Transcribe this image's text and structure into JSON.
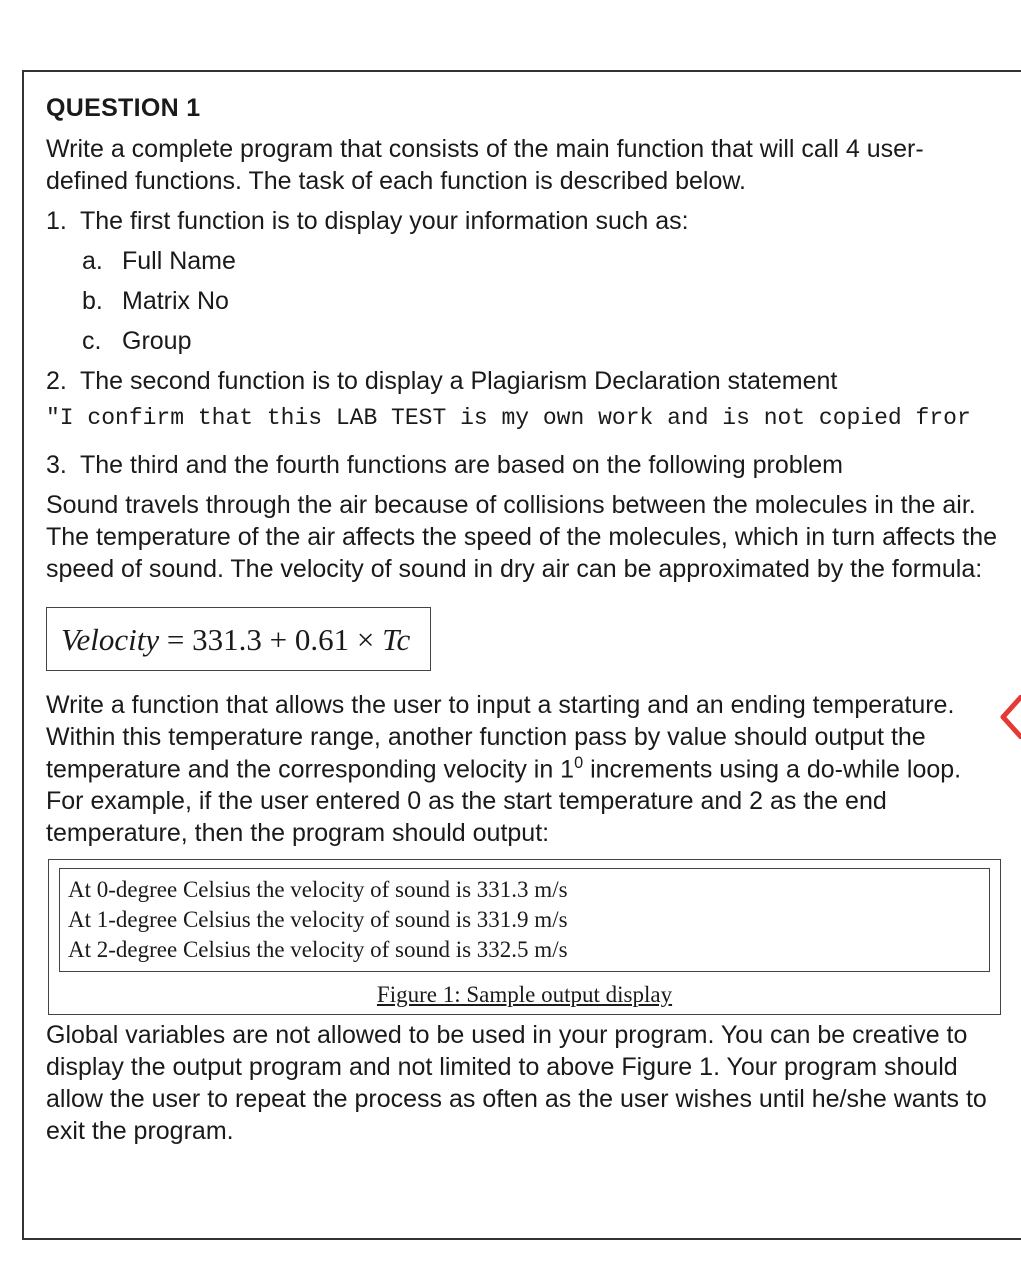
{
  "question": {
    "title": "QUESTION 1",
    "intro": "Write a complete program that consists of the main function that will call 4 user-defined functions. The task of each function is described below.",
    "items": [
      {
        "num": "1.",
        "text": "The first function is to display your information such as:"
      },
      {
        "num": "2.",
        "text": "The second function is to display a Plagiarism Declaration statement"
      },
      {
        "num": "3.",
        "text": "The third and the fourth functions are based on the following problem"
      }
    ],
    "subitems": [
      {
        "num": "a.",
        "text": "Full Name"
      },
      {
        "num": "b.",
        "text": "Matrix No"
      },
      {
        "num": "c.",
        "text": "Group"
      }
    ],
    "plagiarism_code": "\"I confirm that this LAB TEST is my own work and is not copied fror",
    "problem_paragraph": "Sound travels through the air because of collisions between the molecules in the air. The temperature of the air affects the speed of the molecules, which in turn affects the speed of sound. The velocity of sound in dry air can be approximated by the formula:",
    "formula": {
      "lhs": "Velocity",
      "eq": " = ",
      "rhs_a": "331.3 + 0.61 × ",
      "rhs_var": "Tc"
    },
    "task_paragraph_a": "Write a function that allows the user to input a starting and an ending temperature. Within this temperature range, another function pass by value should output the temperature and the corresponding velocity in 1",
    "task_degree_sup": "0",
    "task_paragraph_b": " increments using a do-while loop. For example, if the user entered 0 as the start temperature and 2 as the end temperature, then the program should output:",
    "sample_output": [
      "At 0-degree Celsius the velocity of sound is 331.3 m/s",
      "At 1-degree Celsius the velocity of sound is 331.9 m/s",
      "At 2-degree Celsius the velocity of sound is 332.5 m/s"
    ],
    "figure_caption": "Figure 1: Sample output display",
    "closing": "Global variables are not allowed to be used in your program. You can be creative to display the output program and not limited to above Figure 1.  Your program should allow the user to repeat the process as often as the user wishes until he/she wants to exit the program."
  }
}
